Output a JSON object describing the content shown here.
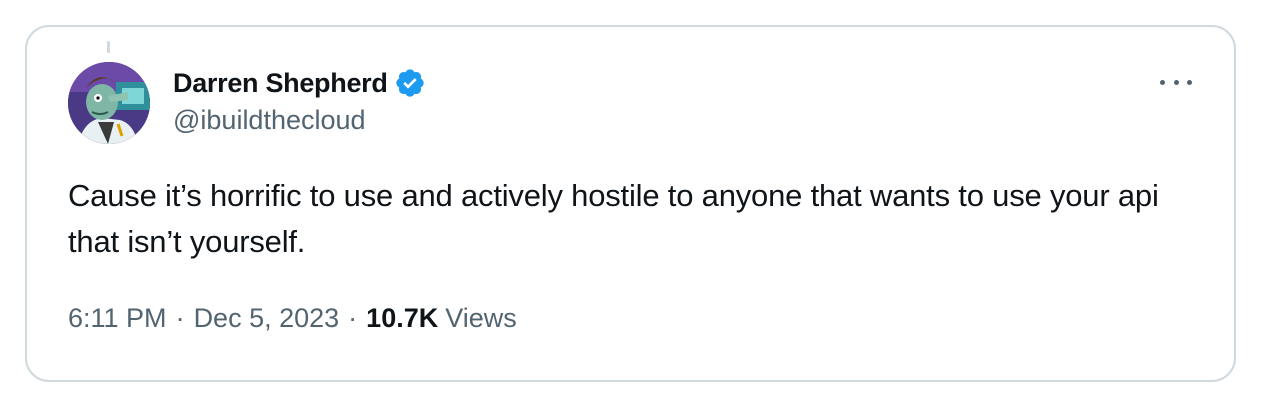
{
  "author": {
    "display_name": "Darren Shepherd",
    "handle": "@ibuildthecloud",
    "verified": true,
    "avatar_icon": "cartoon-scientist-avatar"
  },
  "tweet": {
    "text": "Cause it’s horrific to use and actively hostile to anyone that wants to use your api that isn’t yourself.",
    "time": "6:11 PM",
    "date": "Dec 5, 2023",
    "separator": "·",
    "views_count": "10.7K",
    "views_label": "Views"
  },
  "icons": {
    "verified": "verified-badge-icon",
    "more": "more-options-icon"
  },
  "colors": {
    "text_primary": "#0f1419",
    "text_secondary": "#536471",
    "verified_blue": "#1d9bf0",
    "border": "#cfd9de"
  }
}
